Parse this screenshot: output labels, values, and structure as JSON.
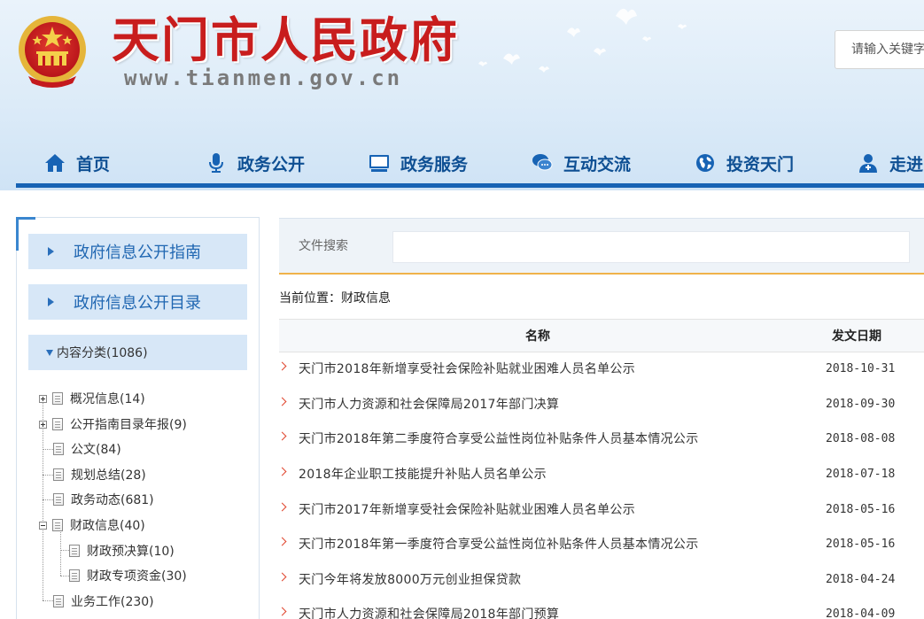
{
  "header": {
    "title": "天门市人民政府",
    "url": "www.tianmen.gov.cn",
    "search_placeholder": "请输入关键字"
  },
  "nav": [
    {
      "label": "首页",
      "icon": "home-icon"
    },
    {
      "label": "政务公开",
      "icon": "microphone-icon"
    },
    {
      "label": "政务服务",
      "icon": "monitor-icon"
    },
    {
      "label": "互动交流",
      "icon": "chat-icon"
    },
    {
      "label": "投资天门",
      "icon": "globe-icon"
    },
    {
      "label": "走进",
      "icon": "user-icon"
    }
  ],
  "sidebar": {
    "guide": "政府信息公开指南",
    "catalog": "政府信息公开目录",
    "category": "内容分类(1086)",
    "tree": [
      {
        "label": "概况信息(14)"
      },
      {
        "label": "公开指南目录年报(9)"
      },
      {
        "label": "公文(84)"
      },
      {
        "label": "规划总结(28)"
      },
      {
        "label": "政务动态(681)"
      },
      {
        "label": "财政信息(40)"
      },
      {
        "label": "财政预决算(10)"
      },
      {
        "label": "财政专项资金(30)"
      },
      {
        "label": "业务工作(230)"
      }
    ]
  },
  "main": {
    "file_search_label": "文件搜索",
    "breadcrumb": "当前位置：财政信息",
    "columns": {
      "name": "名称",
      "date": "发文日期"
    },
    "rows": [
      {
        "title": "天门市2018年新增享受社会保险补贴就业困难人员名单公示",
        "date": "2018-10-31"
      },
      {
        "title": "天门市人力资源和社会保障局2017年部门决算",
        "date": "2018-09-30"
      },
      {
        "title": "天门市2018年第二季度符合享受公益性岗位补贴条件人员基本情况公示",
        "date": "2018-08-08"
      },
      {
        "title": "2018年企业职工技能提升补贴人员名单公示",
        "date": "2018-07-18"
      },
      {
        "title": "天门市2017年新增享受社会保险补贴就业困难人员名单公示",
        "date": "2018-05-16"
      },
      {
        "title": "天门市2018年第一季度符合享受公益性岗位补贴条件人员基本情况公示",
        "date": "2018-05-16"
      },
      {
        "title": "天门今年将发放8000万元创业担保贷款",
        "date": "2018-04-24"
      },
      {
        "title": "天门市人力资源和社会保障局2018年部门预算",
        "date": "2018-04-09"
      }
    ]
  }
}
